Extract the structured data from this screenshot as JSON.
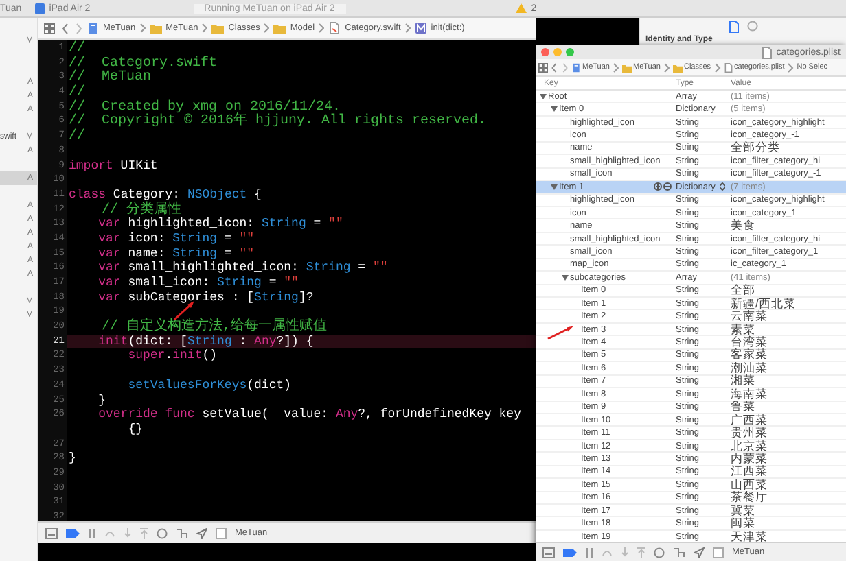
{
  "top_bar": {
    "project_fragment": "Tuan",
    "device": "iPad Air 2",
    "status": "Running MeTuan on iPad Air 2",
    "warnings": "2"
  },
  "sidebar": {
    "items": [
      {
        "kind": "file",
        "status": "M",
        "selected": false
      },
      {
        "kind": "spacer"
      },
      {
        "kind": "spacer"
      },
      {
        "kind": "file",
        "status": "A",
        "selected": false
      },
      {
        "kind": "file",
        "status": "A",
        "selected": false
      },
      {
        "kind": "file",
        "status": "A",
        "selected": false
      },
      {
        "kind": "spacer"
      },
      {
        "kind": "file",
        "name": "swift",
        "status": "M",
        "selected": false
      },
      {
        "kind": "file",
        "status": "A",
        "selected": false
      },
      {
        "kind": "spacer"
      },
      {
        "kind": "file",
        "status": "A",
        "selected": true
      },
      {
        "kind": "spacer"
      },
      {
        "kind": "file",
        "status": "A",
        "selected": false
      },
      {
        "kind": "file",
        "status": "A",
        "selected": false
      },
      {
        "kind": "file",
        "status": "A",
        "selected": false
      },
      {
        "kind": "file",
        "status": "A",
        "selected": false
      },
      {
        "kind": "file",
        "status": "A",
        "selected": false
      },
      {
        "kind": "file",
        "status": "A",
        "selected": false
      },
      {
        "kind": "spacer"
      },
      {
        "kind": "file",
        "status": "M",
        "selected": false
      },
      {
        "kind": "file",
        "status": "M",
        "selected": false
      }
    ]
  },
  "editor": {
    "breadcrumb": [
      {
        "kind": "project",
        "label": "MeTuan"
      },
      {
        "kind": "folder",
        "label": "MeTuan"
      },
      {
        "kind": "folder",
        "label": "Classes"
      },
      {
        "kind": "folder",
        "label": "Model"
      },
      {
        "kind": "swift",
        "label": "Category.swift"
      },
      {
        "kind": "method",
        "label": "init(dict:)"
      }
    ],
    "lines": [
      {
        "number": "1",
        "current": false,
        "segments": [
          {
            "kind": "comment",
            "text": "//"
          }
        ]
      },
      {
        "number": "2",
        "current": false,
        "segments": [
          {
            "kind": "comment",
            "text": "//  Category.swift"
          }
        ]
      },
      {
        "number": "3",
        "current": false,
        "segments": [
          {
            "kind": "comment",
            "text": "//  MeTuan"
          }
        ]
      },
      {
        "number": "4",
        "current": false,
        "segments": [
          {
            "kind": "comment",
            "text": "//"
          }
        ]
      },
      {
        "number": "5",
        "current": false,
        "segments": [
          {
            "kind": "comment",
            "text": "//  Created by xmg on 2016/11/24."
          }
        ]
      },
      {
        "number": "6",
        "current": false,
        "segments": [
          {
            "kind": "comment",
            "text": "//  Copyright © 2016年 hjjuny. All rights reserved."
          }
        ]
      },
      {
        "number": "7",
        "current": false,
        "segments": [
          {
            "kind": "comment",
            "text": "//"
          }
        ]
      },
      {
        "number": "8",
        "current": false
      },
      {
        "number": "9",
        "current": false,
        "segments": [
          {
            "kind": "keyword",
            "text": "import"
          },
          {
            "kind": "plain",
            "text": " UIKit"
          }
        ]
      },
      {
        "number": "10",
        "current": false
      },
      {
        "number": "11",
        "current": false,
        "segments": [
          {
            "kind": "keyword",
            "text": "class"
          },
          {
            "kind": "plain",
            "text": " Category: "
          },
          {
            "kind": "type",
            "text": "NSObject"
          },
          {
            "kind": "plain",
            "text": " {"
          }
        ]
      },
      {
        "number": "12",
        "current": false,
        "segments": [
          {
            "kind": "comment",
            "text": "    // 分类属性"
          }
        ]
      },
      {
        "number": "13",
        "current": false,
        "segments": [
          {
            "kind": "keyword",
            "text": "    var"
          },
          {
            "kind": "plain",
            "text": " highlighted_icon: "
          },
          {
            "kind": "type",
            "text": "String"
          },
          {
            "kind": "plain",
            "text": " = "
          },
          {
            "kind": "string",
            "text": "\"\""
          }
        ]
      },
      {
        "number": "14",
        "current": false,
        "segments": [
          {
            "kind": "keyword",
            "text": "    var"
          },
          {
            "kind": "plain",
            "text": " icon: "
          },
          {
            "kind": "type",
            "text": "String"
          },
          {
            "kind": "plain",
            "text": " = "
          },
          {
            "kind": "string",
            "text": "\"\""
          }
        ]
      },
      {
        "number": "15",
        "current": false,
        "segments": [
          {
            "kind": "keyword",
            "text": "    var"
          },
          {
            "kind": "plain",
            "text": " name: "
          },
          {
            "kind": "type",
            "text": "String"
          },
          {
            "kind": "plain",
            "text": " = "
          },
          {
            "kind": "string",
            "text": "\"\""
          }
        ]
      },
      {
        "number": "16",
        "current": false,
        "segments": [
          {
            "kind": "keyword",
            "text": "    var"
          },
          {
            "kind": "plain",
            "text": " small_highlighted_icon: "
          },
          {
            "kind": "type",
            "text": "String"
          },
          {
            "kind": "plain",
            "text": " = "
          },
          {
            "kind": "string",
            "text": "\"\""
          }
        ]
      },
      {
        "number": "17",
        "current": false,
        "segments": [
          {
            "kind": "keyword",
            "text": "    var"
          },
          {
            "kind": "plain",
            "text": " small_icon: "
          },
          {
            "kind": "type",
            "text": "String"
          },
          {
            "kind": "plain",
            "text": " = "
          },
          {
            "kind": "string",
            "text": "\"\""
          }
        ]
      },
      {
        "number": "18",
        "current": false,
        "segments": [
          {
            "kind": "keyword",
            "text": "    var"
          },
          {
            "kind": "plain",
            "text": " subCategories : ["
          },
          {
            "kind": "type",
            "text": "String"
          },
          {
            "kind": "plain",
            "text": "]?"
          }
        ]
      },
      {
        "number": "19",
        "current": false
      },
      {
        "number": "20",
        "current": false,
        "segments": [
          {
            "kind": "comment",
            "text": "    // 自定义构造方法,给每一属性赋值"
          }
        ]
      },
      {
        "number": "21",
        "current": true,
        "segments": [
          {
            "kind": "keyword",
            "text": "    init"
          },
          {
            "kind": "plain",
            "text": "(dict: ["
          },
          {
            "kind": "type",
            "text": "String"
          },
          {
            "kind": "plain",
            "text": " : "
          },
          {
            "kind": "keyword",
            "text": "Any"
          },
          {
            "kind": "plain",
            "text": "?]) {"
          }
        ]
      },
      {
        "number": "22",
        "current": false,
        "segments": [
          {
            "kind": "keyword",
            "text": "        super"
          },
          {
            "kind": "plain",
            "text": "."
          },
          {
            "kind": "keyword",
            "text": "init"
          },
          {
            "kind": "plain",
            "text": "()"
          }
        ]
      },
      {
        "number": "23",
        "current": false
      },
      {
        "number": "24",
        "current": false,
        "segments": [
          {
            "kind": "type",
            "text": "        setValuesForKeys"
          },
          {
            "kind": "plain",
            "text": "(dict)"
          }
        ]
      },
      {
        "number": "25",
        "current": false,
        "segments": [
          {
            "kind": "plain",
            "text": "    }"
          }
        ]
      },
      {
        "number": "26",
        "current": false,
        "segments": [
          {
            "kind": "keyword",
            "text": "    override func"
          },
          {
            "kind": "plain",
            "text": " setValue(_ value: "
          },
          {
            "kind": "keyword",
            "text": "Any"
          },
          {
            "kind": "plain",
            "text": "?, forUndefinedKey key"
          }
        ]
      },
      {
        "current": false,
        "segments": [
          {
            "kind": "plain",
            "text": "        {}"
          }
        ]
      },
      {
        "number": "27",
        "current": false
      },
      {
        "number": "28",
        "current": false,
        "segments": [
          {
            "kind": "plain",
            "text": "}"
          }
        ]
      },
      {
        "number": "29",
        "current": false
      },
      {
        "number": "30",
        "current": false
      },
      {
        "number": "31",
        "current": false
      },
      {
        "number": "32",
        "current": false
      }
    ],
    "debug_bar": {
      "scheme": "MeTuan"
    }
  },
  "inspector": {
    "section": "Identity and Type"
  },
  "plist_window": {
    "title": "categories.plist",
    "breadcrumb": [
      {
        "kind": "project",
        "label": "MeTuan"
      },
      {
        "kind": "folder",
        "label": "MeTuan"
      },
      {
        "kind": "folder",
        "label": "Classes"
      },
      {
        "kind": "plist",
        "label": "categories.plist"
      },
      {
        "kind": "text",
        "label": "No Selec"
      }
    ],
    "columns": [
      "Key",
      "Type",
      "Value"
    ],
    "rows": [
      {
        "key": "Root",
        "type": "Array",
        "value": "(11 items)",
        "expanded": true,
        "selected": false,
        "children": [
          {
            "key": "Item 0",
            "type": "Dictionary",
            "value": "(5 items)",
            "expanded": true,
            "selected": false,
            "children": [
              {
                "key": "highlighted_icon",
                "type": "String",
                "value": "icon_category_highlight",
                "selected": false
              },
              {
                "key": "icon",
                "type": "String",
                "value": "icon_category_-1",
                "selected": false
              },
              {
                "key": "name",
                "type": "String",
                "value": "全部分类",
                "selected": false
              },
              {
                "key": "small_highlighted_icon",
                "type": "String",
                "value": "icon_filter_category_hi",
                "selected": false
              },
              {
                "key": "small_icon",
                "type": "String",
                "value": "icon_filter_category_-1",
                "selected": false
              }
            ]
          },
          {
            "key": "Item 1",
            "type": "Dictionary",
            "value": "(7 items)",
            "expanded": true,
            "selected": true,
            "children": [
              {
                "key": "highlighted_icon",
                "type": "String",
                "value": "icon_category_highlight",
                "selected": false
              },
              {
                "key": "icon",
                "type": "String",
                "value": "icon_category_1",
                "selected": false
              },
              {
                "key": "name",
                "type": "String",
                "value": "美食",
                "selected": false
              },
              {
                "key": "small_highlighted_icon",
                "type": "String",
                "value": "icon_filter_category_hi",
                "selected": false
              },
              {
                "key": "small_icon",
                "type": "String",
                "value": "icon_filter_category_1",
                "selected": false
              },
              {
                "key": "map_icon",
                "type": "String",
                "value": "ic_category_1",
                "selected": false
              },
              {
                "key": "subcategories",
                "type": "Array",
                "value": "(41 items)",
                "expanded": true,
                "selected": false,
                "children": [
                  {
                    "key": "Item 0",
                    "type": "String",
                    "value": "全部",
                    "selected": false
                  },
                  {
                    "key": "Item 1",
                    "type": "String",
                    "value": "新疆/西北菜",
                    "selected": false
                  },
                  {
                    "key": "Item 2",
                    "type": "String",
                    "value": "云南菜",
                    "selected": false
                  },
                  {
                    "key": "Item 3",
                    "type": "String",
                    "value": "素菜",
                    "selected": false
                  },
                  {
                    "key": "Item 4",
                    "type": "String",
                    "value": "台湾菜",
                    "selected": false
                  },
                  {
                    "key": "Item 5",
                    "type": "String",
                    "value": "客家菜",
                    "selected": false
                  },
                  {
                    "key": "Item 6",
                    "type": "String",
                    "value": "潮汕菜",
                    "selected": false
                  },
                  {
                    "key": "Item 7",
                    "type": "String",
                    "value": "湘菜",
                    "selected": false
                  },
                  {
                    "key": "Item 8",
                    "type": "String",
                    "value": "海南菜",
                    "selected": false
                  },
                  {
                    "key": "Item 9",
                    "type": "String",
                    "value": "鲁菜",
                    "selected": false
                  },
                  {
                    "key": "Item 10",
                    "type": "String",
                    "value": "广西菜",
                    "selected": false
                  },
                  {
                    "key": "Item 11",
                    "type": "String",
                    "value": "贵州菜",
                    "selected": false
                  },
                  {
                    "key": "Item 12",
                    "type": "String",
                    "value": "北京菜",
                    "selected": false
                  },
                  {
                    "key": "Item 13",
                    "type": "String",
                    "value": "内蒙菜",
                    "selected": false
                  },
                  {
                    "key": "Item 14",
                    "type": "String",
                    "value": "江西菜",
                    "selected": false
                  },
                  {
                    "key": "Item 15",
                    "type": "String",
                    "value": "山西菜",
                    "selected": false
                  },
                  {
                    "key": "Item 16",
                    "type": "String",
                    "value": "茶餐厅",
                    "selected": false
                  },
                  {
                    "key": "Item 17",
                    "type": "String",
                    "value": "冀菜",
                    "selected": false
                  },
                  {
                    "key": "Item 18",
                    "type": "String",
                    "value": "闽菜",
                    "selected": false
                  },
                  {
                    "key": "Item 19",
                    "type": "String",
                    "value": "天津菜",
                    "selected": false
                  }
                ]
              }
            ]
          }
        ]
      }
    ],
    "debug_bar": {
      "scheme": "MeTuan"
    }
  }
}
